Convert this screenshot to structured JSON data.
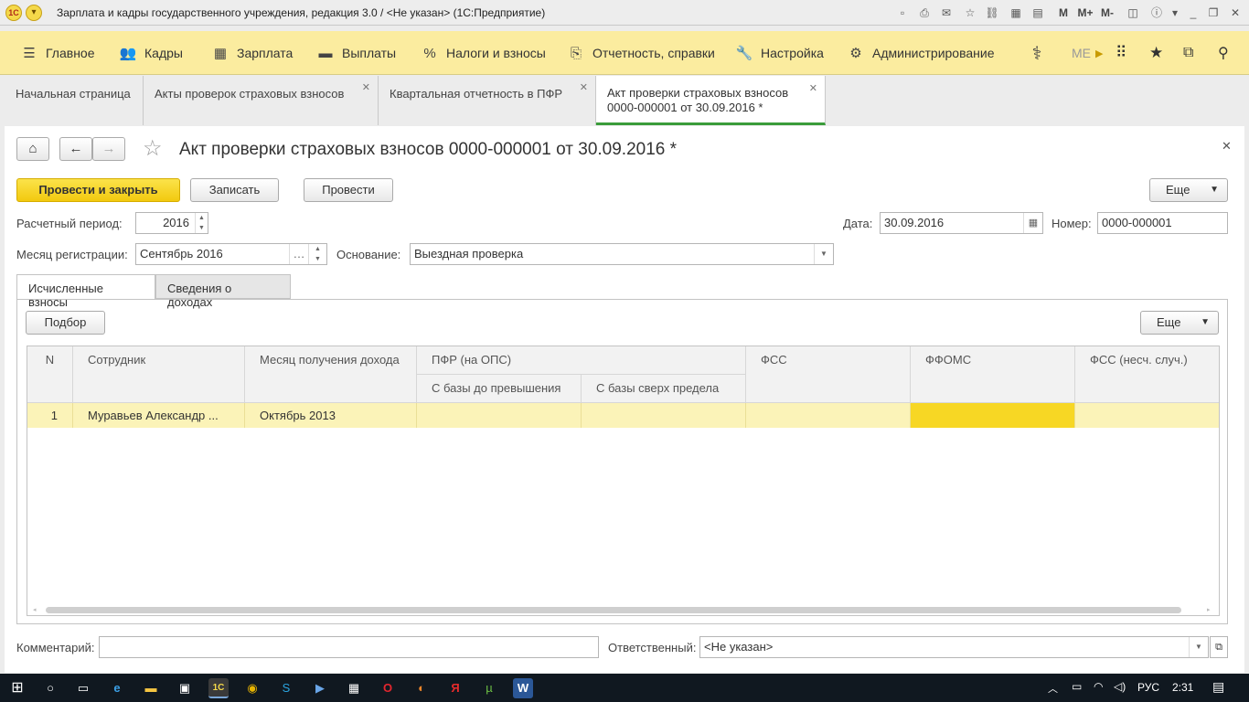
{
  "window": {
    "title": "Зарплата и кадры государственного учреждения, редакция 3.0 / <Не указан>  (1С:Предприятие)",
    "title_buttons": [
      "M",
      "M+",
      "M-"
    ]
  },
  "sections": [
    {
      "label": "Главное",
      "icon": "menu-icon"
    },
    {
      "label": "Кадры",
      "icon": "people-icon"
    },
    {
      "label": "Зарплата",
      "icon": "calculator-icon"
    },
    {
      "label": "Выплаты",
      "icon": "wallet-icon"
    },
    {
      "label": "Налоги и взносы",
      "icon": "percent-icon"
    },
    {
      "label": "Отчетность, справки",
      "icon": "document-icon"
    },
    {
      "label": "Настройка",
      "icon": "wrench-icon"
    },
    {
      "label": "Администрирование",
      "icon": "gear-icon"
    }
  ],
  "sections_extra": "МЕ",
  "open_tabs": [
    {
      "label": "Начальная страница"
    },
    {
      "label": "Акты проверок страховых взносов"
    },
    {
      "label": "Квартальная отчетность в ПФР"
    },
    {
      "label": "Акт проверки страховых взносов 0000-000001 от 30.09.2016 *"
    }
  ],
  "form": {
    "title": "Акт проверки страховых взносов 0000-000001 от 30.09.2016 *",
    "buttons": {
      "post_close": "Провести и закрыть",
      "save": "Записать",
      "post": "Провести",
      "more": "Еще"
    },
    "period_label": "Расчетный период:",
    "period_value": "2016",
    "month_label": "Месяц регистрации:",
    "month_value": "Сентябрь 2016",
    "basis_label": "Основание:",
    "basis_value": "Выездная проверка",
    "date_label": "Дата:",
    "date_value": "30.09.2016",
    "number_label": "Номер:",
    "number_value": "0000-000001",
    "tabs": [
      "Исчисленные взносы",
      "Сведения о доходах"
    ],
    "pick_button": "Подбор",
    "grid_more": "Еще",
    "comment_label": "Комментарий:",
    "comment_value": "",
    "responsible_label": "Ответственный:",
    "responsible_value": "<Не указан>"
  },
  "grid": {
    "headers": {
      "n": "N",
      "employee": "Сотрудник",
      "income_month": "Месяц получения дохода",
      "pfr": "ПФР (на ОПС)",
      "pfr_base": "С базы до превышения",
      "pfr_over": "С базы сверх предела",
      "fss": "ФСС",
      "ffoms": "ФФОМС",
      "fss_ns": "ФСС (несч. случ.)"
    },
    "rows": [
      {
        "n": "1",
        "employee": "Муравьев Александр ...",
        "income_month": "Октябрь 2013",
        "pfr_base": "",
        "pfr_over": "",
        "fss": "",
        "ffoms": "",
        "fss_ns": ""
      }
    ]
  },
  "taskbar": {
    "lang": "РУС",
    "time": "2:31"
  },
  "colors": {
    "accent_yellow": "#f2c90f",
    "section_bg": "#fbec9f",
    "active_tab_underline": "#3a9c3a",
    "selected_row": "#fbf3b8",
    "selected_cell": "#f7d724"
  }
}
